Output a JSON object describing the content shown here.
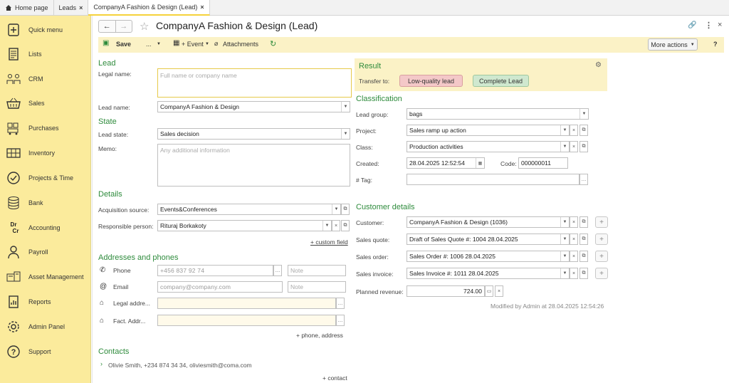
{
  "tabs": [
    {
      "label": "Home page"
    },
    {
      "label": "Leads"
    },
    {
      "label": "CompanyA Fashion & Design (Lead)"
    }
  ],
  "sidebar": {
    "items": [
      {
        "label": "Quick menu",
        "icon": "quick-menu-icon"
      },
      {
        "label": "Lists",
        "icon": "lists-icon"
      },
      {
        "label": "CRM",
        "icon": "crm-icon"
      },
      {
        "label": "Sales",
        "icon": "basket-icon"
      },
      {
        "label": "Purchases",
        "icon": "purchases-icon"
      },
      {
        "label": "Inventory",
        "icon": "inventory-icon"
      },
      {
        "label": "Projects & Time",
        "icon": "clock-icon"
      },
      {
        "label": "Bank",
        "icon": "coins-icon"
      },
      {
        "label": "Accounting",
        "icon": "dr-cr-icon"
      },
      {
        "label": "Payroll",
        "icon": "person-icon"
      },
      {
        "label": "Asset Management",
        "icon": "asset-icon"
      },
      {
        "label": "Reports",
        "icon": "reports-icon"
      },
      {
        "label": "Admin Panel",
        "icon": "gear-icon"
      },
      {
        "label": "Support",
        "icon": "question-icon"
      }
    ],
    "accounting_dr": "Dr",
    "accounting_cr": "Cr"
  },
  "header": {
    "title": "CompanyA Fashion & Design (Lead)"
  },
  "toolbar": {
    "save": "Save",
    "dots": "...",
    "event": "+ Event",
    "attachments": "Attachments",
    "more_actions": "More actions",
    "help": "?"
  },
  "lead": {
    "section": "Lead",
    "legal_name_label": "Legal name:",
    "legal_name_placeholder": "Full name or company name",
    "lead_name_label": "Lead name:",
    "lead_name_value": "CompanyA Fashion & Design"
  },
  "state": {
    "section": "State",
    "lead_state_label": "Lead state:",
    "lead_state_value": "Sales decision",
    "memo_label": "Memo:",
    "memo_placeholder": "Any additional information"
  },
  "details": {
    "section": "Details",
    "acq_label": "Acquisition source:",
    "acq_value": "Events&Conferences",
    "resp_label": "Responsible person:",
    "resp_value": "Rituraj Borkakoty",
    "custom_field": "+ custom field"
  },
  "addresses": {
    "section": "Addresses and phones",
    "phone_label": "Phone",
    "phone_value": "+456 837 92 74",
    "phone_note": "Note",
    "email_label": "Email",
    "email_value": "company@company.com",
    "email_note": "Note",
    "legal_label": "Legal addre...",
    "fact_label": "Fact. Addr...",
    "add_link": "+ phone, address"
  },
  "contacts": {
    "section": "Contacts",
    "item": "Olivie Smith, +234 874 34 34, oliviesmith@coma.com",
    "add_link": "+ contact"
  },
  "result": {
    "section": "Result",
    "transfer_label": "Transfer to:",
    "low_quality": "Low-quality lead",
    "complete": "Complete Lead"
  },
  "classification": {
    "section": "Classification",
    "group_label": "Lead group:",
    "group_value": "bags",
    "project_label": "Project:",
    "project_value": "Sales ramp up action",
    "class_label": "Class:",
    "class_value": "Production activities",
    "created_label": "Created:",
    "created_value": "28.04.2025 12:52:54",
    "code_label": "Code:",
    "code_value": "000000011",
    "tag_label": "# Tag:"
  },
  "customer": {
    "section": "Customer details",
    "customer_label": "Customer:",
    "customer_value": "CompanyA Fashion & Design (1036)",
    "quote_label": "Sales quote:",
    "quote_value": "Draft of Sales Quote #: 1004 28.04.2025",
    "order_label": "Sales order:",
    "order_value": "Sales Order #: 1006 28.04.2025",
    "invoice_label": "Sales invoice:",
    "invoice_value": "Sales Invoice #: 1011 28.04.2025",
    "revenue_label": "Planned revenue:",
    "revenue_value": "724.00",
    "modified": "Modified by Admin at 28.04.2025 12:54:26"
  },
  "colors": {
    "accent": "#2e8b3c",
    "sidebar": "#fbeb9c",
    "toolbar": "#fbf2c6"
  }
}
